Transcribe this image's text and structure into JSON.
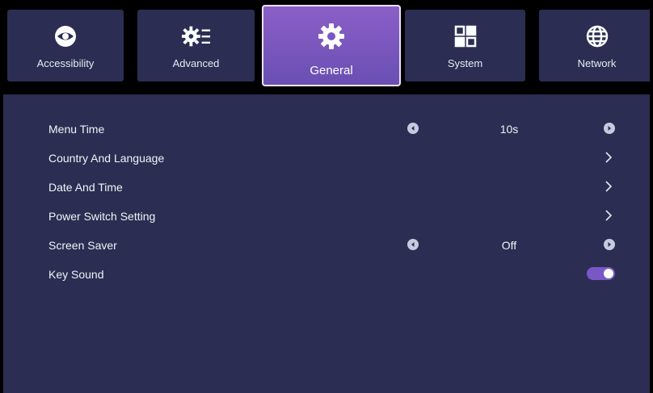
{
  "tabs": [
    {
      "label": "Accessibility",
      "icon": "eye-icon"
    },
    {
      "label": "Advanced",
      "icon": "gear-list-icon"
    },
    {
      "label": "General",
      "icon": "gear-icon",
      "active": true
    },
    {
      "label": "System",
      "icon": "grid-icon"
    },
    {
      "label": "Network",
      "icon": "globe-icon"
    }
  ],
  "menu": {
    "items": [
      {
        "label": "Menu Time",
        "control": "selector",
        "value": "10s"
      },
      {
        "label": "Country And Language",
        "control": "submenu"
      },
      {
        "label": "Date And Time",
        "control": "submenu"
      },
      {
        "label": "Power Switch Setting",
        "control": "submenu"
      },
      {
        "label": "Screen Saver",
        "control": "selector",
        "value": "Off"
      },
      {
        "label": "Key Sound",
        "control": "toggle",
        "state": "on"
      }
    ]
  },
  "colors": {
    "background": "#2b2e52",
    "topbar": "#000000",
    "active_tab": "#7a57c6",
    "toggle_on": "#7a57c6"
  }
}
